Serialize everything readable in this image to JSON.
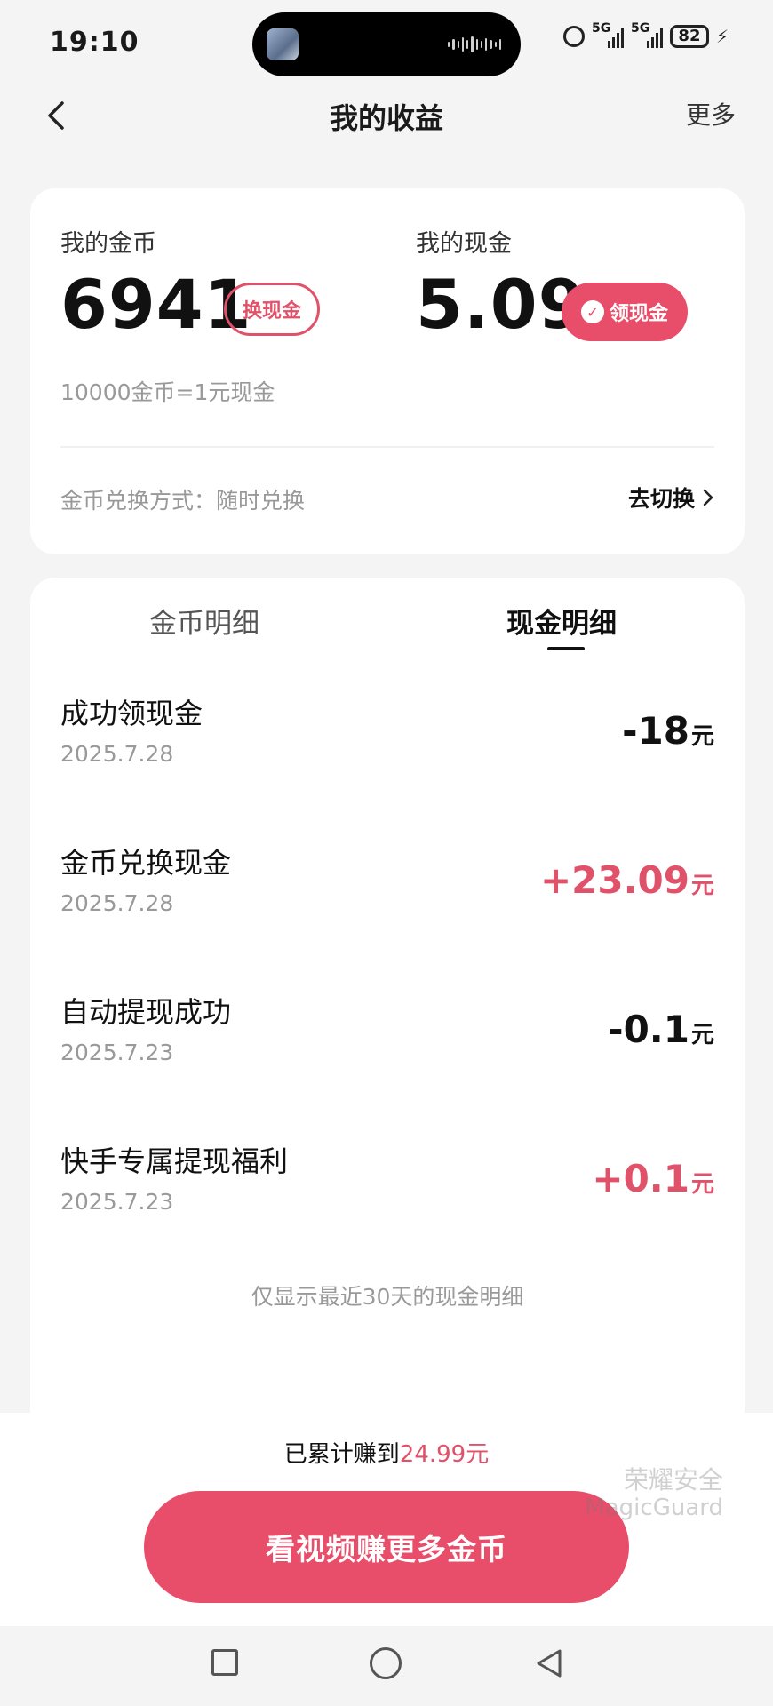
{
  "status_bar": {
    "time": "19:10",
    "network_1": "5G",
    "network_2": "5G",
    "battery": "82"
  },
  "header": {
    "title": "我的收益",
    "more": "更多"
  },
  "balance": {
    "coins_label": "我的金币",
    "coins_value": "6941",
    "exchange_button": "换现金",
    "cash_label": "我的现金",
    "cash_value": "5.09",
    "claim_button": "领现金",
    "rate": "10000金币=1元现金",
    "method": "金币兑换方式：随时兑换",
    "switch_label": "去切换"
  },
  "tabs": [
    {
      "label": "金币明细",
      "active": false
    },
    {
      "label": "现金明细",
      "active": true
    }
  ],
  "records": [
    {
      "name": "成功领现金",
      "date": "2025.7.28",
      "amount": "-18",
      "unit": "元"
    },
    {
      "name": "金币兑换现金",
      "date": "2025.7.28",
      "amount": "+23.09",
      "unit": "元"
    },
    {
      "name": "自动提现成功",
      "date": "2025.7.23",
      "amount": "-0.1",
      "unit": "元"
    },
    {
      "name": "快手专属提现福利",
      "date": "2025.7.23",
      "amount": "+0.1",
      "unit": "元"
    }
  ],
  "note": "仅显示最近30天的现金明细",
  "footer": {
    "earned_prefix": "已累计赚到",
    "earned_amount": "24.99元",
    "cta": "看视频赚更多金币",
    "watermark_1": "荣耀安全",
    "watermark_2": "MagicGuard"
  },
  "colors": {
    "accent": "#e84d6a",
    "positive": "#e0516a",
    "background": "#f4f4f4"
  }
}
